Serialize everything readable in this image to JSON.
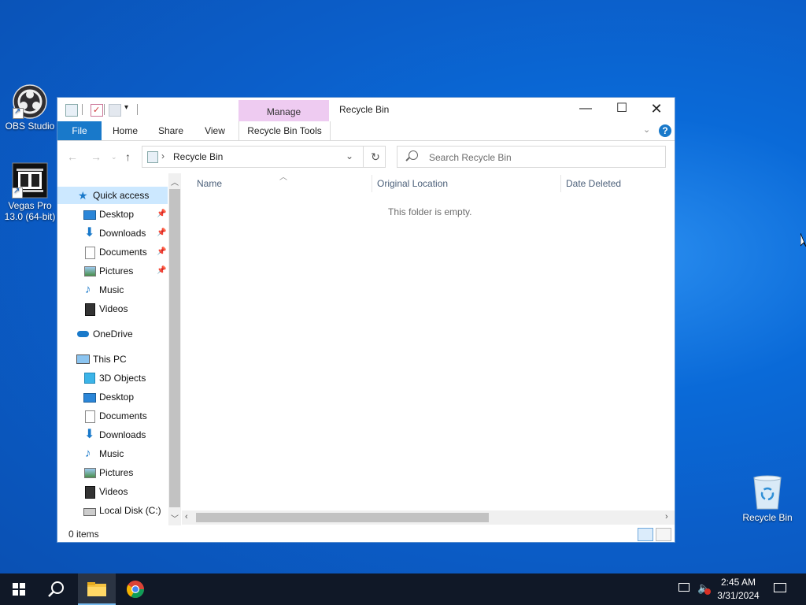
{
  "desktop": {
    "icons": [
      {
        "label": "OBS Studio"
      },
      {
        "label": "Vegas Pro 13.0 (64-bit)"
      },
      {
        "label": "Recycle Bin"
      }
    ]
  },
  "window": {
    "title": "Recycle Bin",
    "context_tab": "Manage",
    "ribbon_tabs": [
      "File",
      "Home",
      "Share",
      "View",
      "Recycle Bin Tools"
    ],
    "address": "Recycle Bin",
    "search_placeholder": "Search Recycle Bin",
    "nav": [
      {
        "label": "Quick access"
      },
      {
        "label": "Desktop"
      },
      {
        "label": "Downloads"
      },
      {
        "label": "Documents"
      },
      {
        "label": "Pictures"
      },
      {
        "label": "Music"
      },
      {
        "label": "Videos"
      },
      {
        "label": "OneDrive"
      },
      {
        "label": "This PC"
      },
      {
        "label": "3D Objects"
      },
      {
        "label": "Desktop"
      },
      {
        "label": "Documents"
      },
      {
        "label": "Downloads"
      },
      {
        "label": "Music"
      },
      {
        "label": "Pictures"
      },
      {
        "label": "Videos"
      },
      {
        "label": "Local Disk (C:)"
      }
    ],
    "columns": [
      "Name",
      "Original Location",
      "Date Deleted"
    ],
    "empty_message": "This folder is empty.",
    "status": "0 items"
  },
  "taskbar": {
    "time": "2:45 AM",
    "date": "3/31/2024"
  },
  "colors": {
    "accent": "#1979ca",
    "manage_tab": "#eecbf1",
    "selection": "#cce8ff",
    "taskbar": "#101827"
  }
}
